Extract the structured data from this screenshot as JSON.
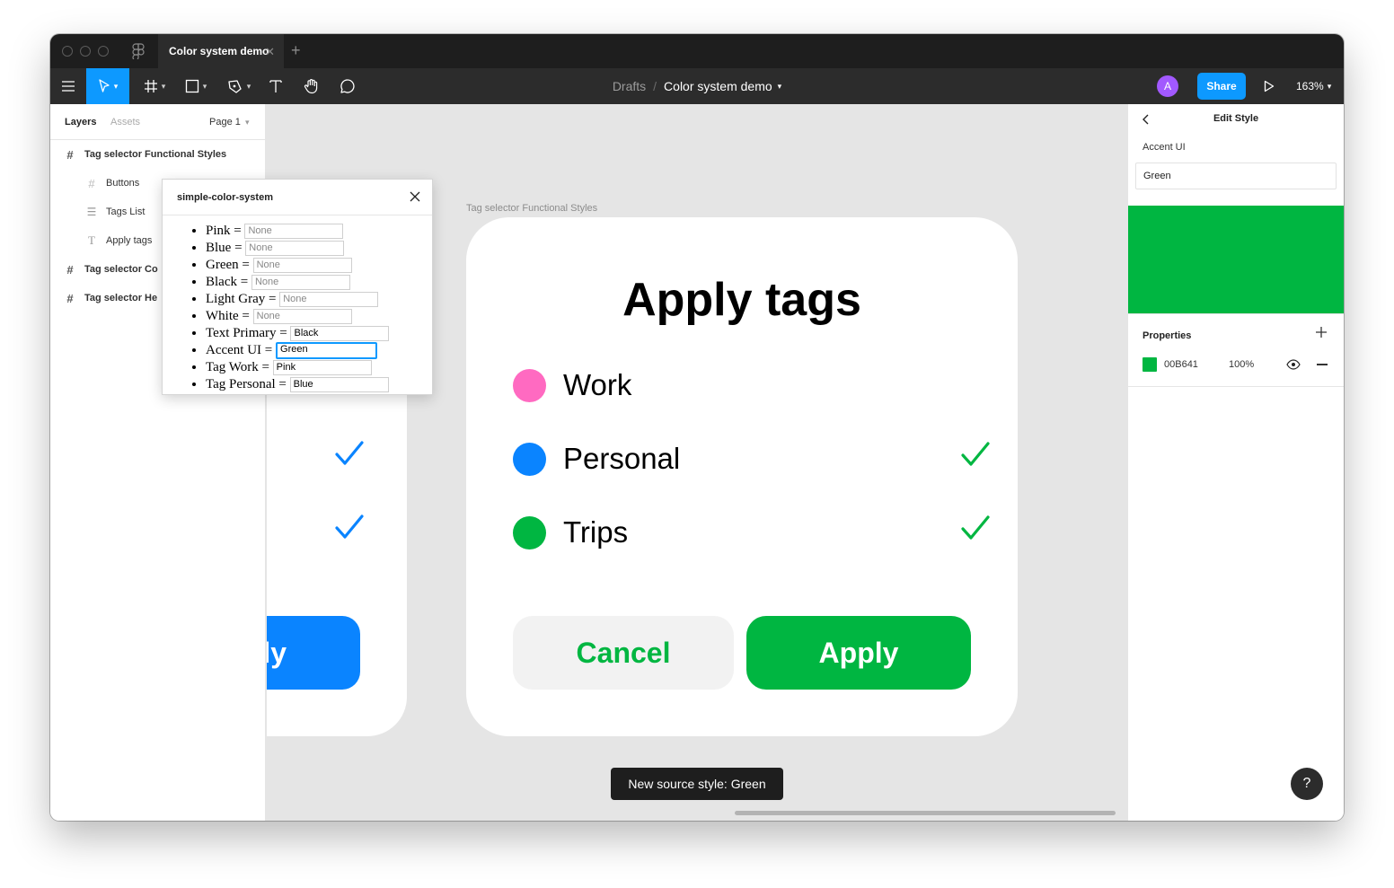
{
  "window": {
    "tab_title": "Color system demo",
    "tab_close": "✕",
    "tab_add": "+"
  },
  "toolbar": {
    "breadcrumb_parent": "Drafts",
    "breadcrumb_separator": "/",
    "breadcrumb_current": "Color system demo",
    "avatar_initial": "A",
    "share_label": "Share",
    "zoom_label": "163%"
  },
  "left_panel": {
    "tabs": [
      "Layers",
      "Assets"
    ],
    "page_label": "Page 1",
    "layers": [
      {
        "label": "Tag selector Functional Styles",
        "icon": "frame-icon",
        "bold": true
      },
      {
        "label": "Buttons",
        "icon": "frame-icon",
        "bold": false
      },
      {
        "label": "Tags List",
        "icon": "autolayout-icon",
        "bold": false
      },
      {
        "label": "Apply tags",
        "icon": "text-icon",
        "bold": false
      },
      {
        "label": "Tag selector Co",
        "icon": "frame-icon",
        "bold": true
      },
      {
        "label": "Tag selector He",
        "icon": "frame-icon",
        "bold": true
      }
    ]
  },
  "plugin": {
    "title": "simple-color-system",
    "rows": [
      {
        "label": "Pink =",
        "value": "None",
        "empty": true
      },
      {
        "label": "Blue =",
        "value": "None",
        "empty": true
      },
      {
        "label": "Green =",
        "value": "None",
        "empty": true
      },
      {
        "label": "Black =",
        "value": "None",
        "empty": true
      },
      {
        "label": "Light Gray =",
        "value": "None",
        "empty": true
      },
      {
        "label": "White =",
        "value": "None",
        "empty": true
      },
      {
        "label": "Text Primary =",
        "value": "Black",
        "empty": false
      },
      {
        "label": "Accent UI =",
        "value": "Green",
        "empty": false,
        "focused": true
      },
      {
        "label": "Tag Work =",
        "value": "Pink",
        "empty": false
      },
      {
        "label": "Tag Personal =",
        "value": "Blue",
        "empty": false
      }
    ]
  },
  "canvas": {
    "frame_label": "Tag selector Functional Styles",
    "partial_button_label": "ly",
    "card": {
      "title": "Apply tags",
      "tags": [
        {
          "name": "Work",
          "color": "#ff6ac1",
          "checked": false
        },
        {
          "name": "Personal",
          "color": "#0a84ff",
          "checked": true
        },
        {
          "name": "Trips",
          "color": "#00b641",
          "checked": true
        }
      ],
      "cancel_label": "Cancel",
      "apply_label": "Apply"
    },
    "toast": "New source style: Green"
  },
  "right_panel": {
    "title": "Edit Style",
    "style_name": "Accent UI",
    "style_input": "Green",
    "properties_label": "Properties",
    "fill_hex": "00B641",
    "fill_opacity": "100%",
    "help_label": "?"
  },
  "colors": {
    "accent_green": "#00B641",
    "accent_blue": "#0A84FF",
    "tag_pink": "#FF6AC1",
    "figma_blue": "#0D99FF",
    "avatar_purple": "#A259FF"
  }
}
